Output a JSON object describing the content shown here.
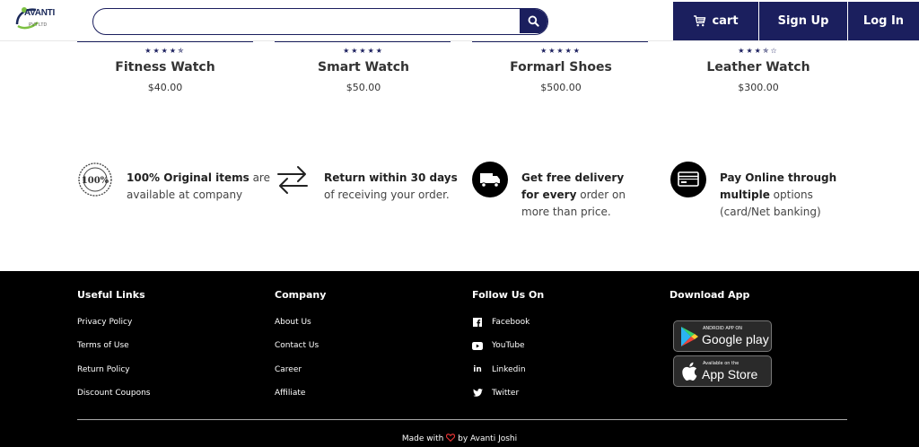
{
  "header": {
    "logo_text": "AVANTI",
    "logo_sub": "PVT LTD",
    "search_placeholder": "",
    "nav": {
      "cart_label": "cart",
      "signup_label": "Sign Up",
      "login_label": "Log In"
    }
  },
  "products": [
    {
      "stars": "★★★★✯",
      "rating": 4.5,
      "name": "Fitness Watch",
      "price": "$40.00"
    },
    {
      "stars": "★★★★★",
      "rating": 5,
      "name": "Smart Watch",
      "price": "$50.00"
    },
    {
      "stars": "★★★★★",
      "rating": 5,
      "name": "Formarl Shoes",
      "price": "$500.00"
    },
    {
      "stars": "★★★✯☆",
      "rating": 3.5,
      "name": "Leather Watch",
      "price": "$300.00"
    }
  ],
  "features": [
    {
      "icon": "original-badge-icon",
      "bold": "100% Original items",
      "rest": " are available at company"
    },
    {
      "icon": "return-arrows-icon",
      "bold": "Return within 30 days",
      "rest": " of receiving your order."
    },
    {
      "icon": "delivery-truck-icon",
      "bold": "Get free delivery for every",
      "rest": " order on more than price."
    },
    {
      "icon": "credit-card-icon",
      "bold": "Pay Online through multiple",
      "rest": " options (card/Net banking)"
    }
  ],
  "footer": {
    "useful_links": {
      "title": "Useful Links",
      "links": [
        "Privacy Policy",
        "Terms of Use",
        "Return Policy",
        "Discount Coupons"
      ]
    },
    "company": {
      "title": "Company",
      "links": [
        "About Us",
        "Contact Us",
        "Career",
        "Affiliate"
      ]
    },
    "follow": {
      "title": "Follow Us On",
      "links": [
        "Facebook",
        "YouTube",
        "Linkedin",
        "Twitter"
      ],
      "icons": [
        "facebook-icon",
        "youtube-icon",
        "linkedin-icon",
        "twitter-icon"
      ]
    },
    "download": {
      "title": "Download App",
      "google_small": "ANDROID APP ON",
      "google_big": "Google play",
      "apple_small": "Available on the",
      "apple_big": "App Store"
    },
    "credit_before": "Made with",
    "credit_after": "by Avanti Joshi"
  },
  "colors": {
    "navy": "#1b1f5e",
    "footer_bg": "#000000",
    "heart": "#e33333"
  }
}
